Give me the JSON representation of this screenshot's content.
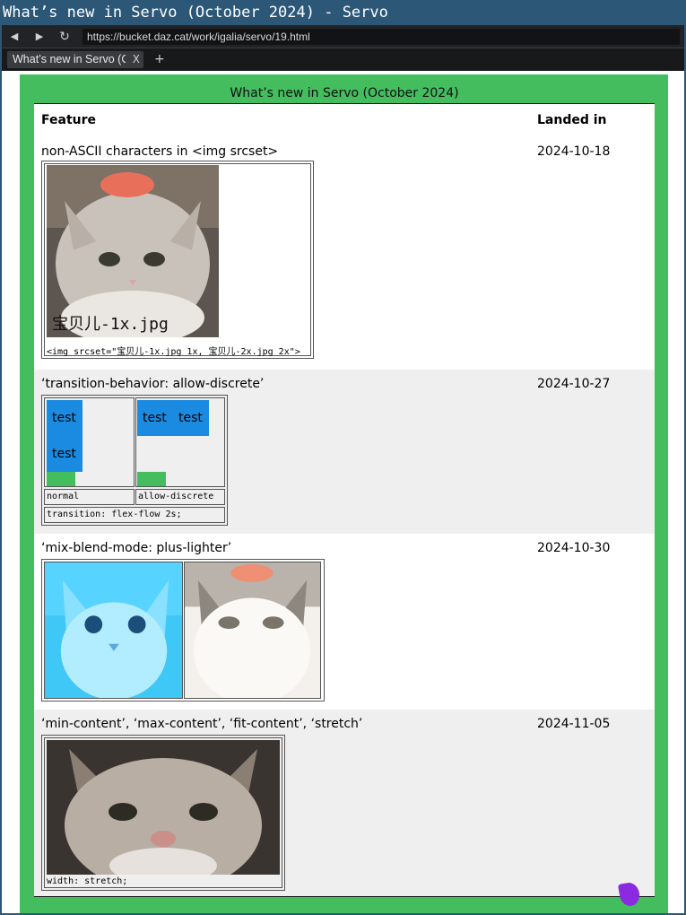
{
  "window": {
    "title": "What’s new in Servo (October 2024) - Servo"
  },
  "toolbar": {
    "back": "◀",
    "forward": "▶",
    "reload": "↻",
    "url": "https://bucket.daz.cat/work/igalia/servo/19.html"
  },
  "tab": {
    "title": "What’s new in Servo (Octo…",
    "close": "X",
    "new": "+"
  },
  "table": {
    "caption": "What’s new in Servo (October 2024)",
    "headers": {
      "feature": "Feature",
      "landed": "Landed in"
    },
    "rows": [
      {
        "feature": "non-ASCII characters in <img srcset>",
        "date": "2024-10-18",
        "image_caption": "宝贝儿-1x.jpg",
        "code": "<img srcset=\"宝贝儿-1x.jpg 1x, 宝贝儿-2x.jpg 2x\">"
      },
      {
        "feature": "‘transition-behavior: allow-discrete’",
        "date": "2024-10-27",
        "test_label": "test",
        "normal_label": "normal",
        "discrete_label": "allow-discrete",
        "code": "transition: flex-flow 2s;"
      },
      {
        "feature": "‘mix-blend-mode: plus-lighter’",
        "date": "2024-10-30"
      },
      {
        "feature": "‘min-content’, ‘max-content’, ‘fit-content’, ‘stretch’",
        "date": "2024-11-05",
        "code": "width: stretch;"
      }
    ]
  },
  "colors": {
    "accent": "#44bd5f",
    "titlebar": "#2c5777",
    "test_blue": "#1a8be0",
    "row_alt": "#efefef"
  }
}
